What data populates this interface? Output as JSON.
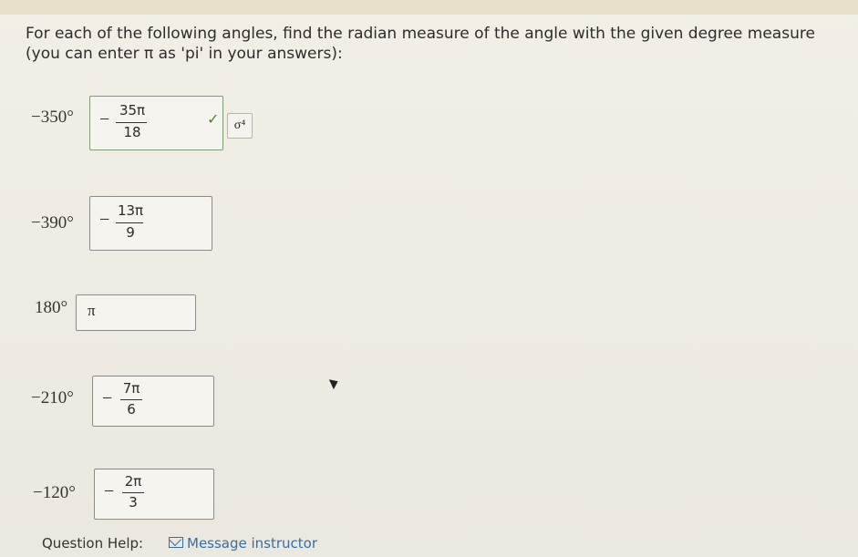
{
  "instructions": "For each of the following angles, find the radian measure of the angle with the given degree measure (you can enter π as 'pi' in your answers):",
  "questions": [
    {
      "degree": "−350°",
      "sign": "−",
      "num": "35π",
      "den": "18"
    },
    {
      "degree": "−390°",
      "sign": "−",
      "num": "13π",
      "den": "9"
    },
    {
      "degree": "180°",
      "plain": "π"
    },
    {
      "degree": "−210°",
      "sign": "−",
      "num": "7π",
      "den": "6"
    },
    {
      "degree": "−120°",
      "sign": "−",
      "num": "2π",
      "den": "3"
    }
  ],
  "status": {
    "check": "✓"
  },
  "tools": {
    "keypad": "σ⁴"
  },
  "footer": {
    "help_label": "Question Help:",
    "message_label": "Message instructor"
  }
}
